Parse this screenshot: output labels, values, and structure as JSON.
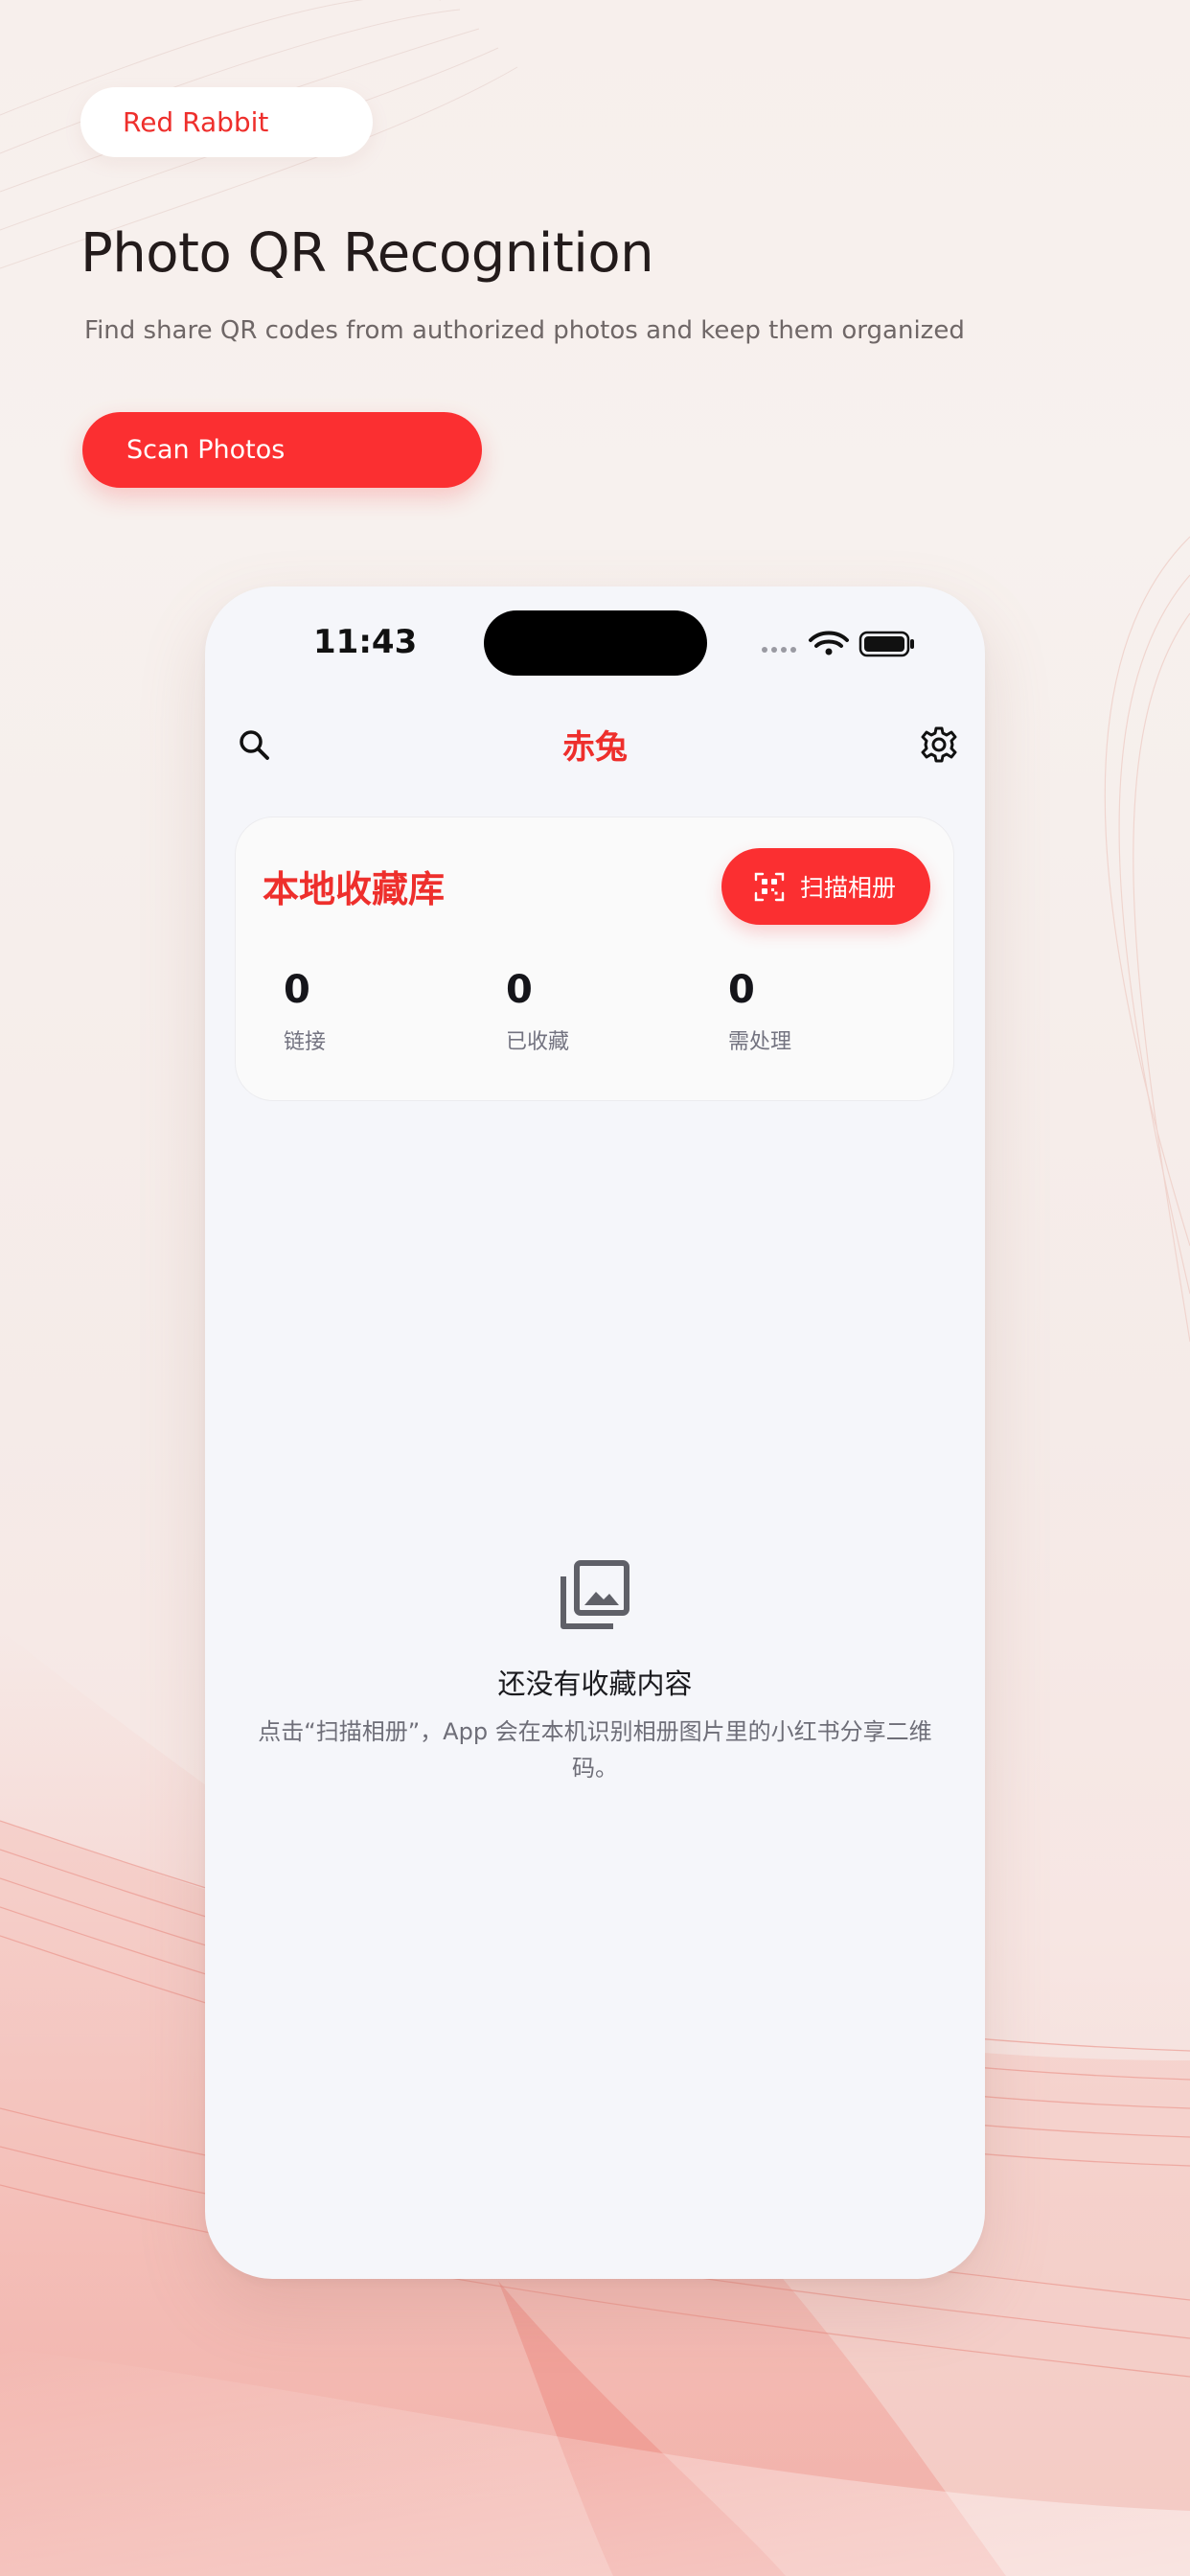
{
  "colors": {
    "accent": "#fb2f31",
    "brand_text": "#ee2f2c",
    "phone_bg": "#f5f6fa"
  },
  "brand": {
    "name": "Red Rabbit"
  },
  "hero": {
    "title": "Photo QR Recognition",
    "subtitle": "Find share QR codes from authorized photos and keep them organized",
    "cta_label": "Scan Photos"
  },
  "status_bar": {
    "time": "11:43",
    "icons": [
      "signal-dots-icon",
      "wifi-icon",
      "battery-icon"
    ]
  },
  "nav": {
    "title": "赤兔",
    "left_icon": "search-icon",
    "right_icon": "gear-icon"
  },
  "library": {
    "title": "本地收藏库",
    "scan_button_label": "扫描相册",
    "scan_button_icon": "qr-scan-icon",
    "stats": [
      {
        "value": "0",
        "label": "链接"
      },
      {
        "value": "0",
        "label": "已收藏"
      },
      {
        "value": "0",
        "label": "需处理"
      }
    ]
  },
  "empty_state": {
    "icon": "photo-library-icon",
    "title": "还没有收藏内容",
    "description": "点击“扫描相册”，App 会在本机识别相册图片里的小红书分享二维码。"
  }
}
